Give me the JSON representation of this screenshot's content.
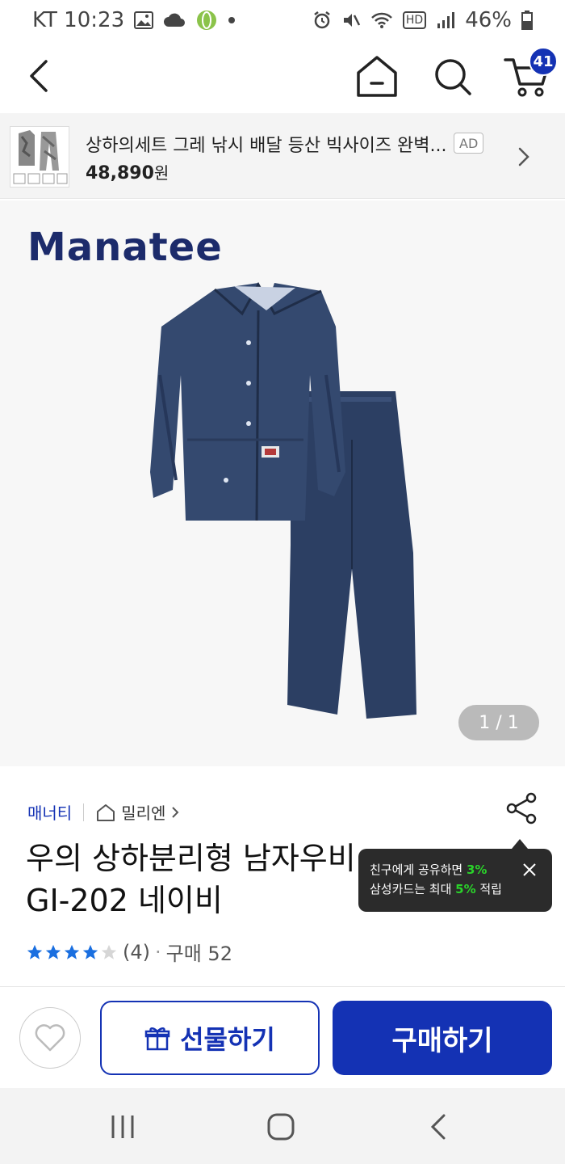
{
  "status_bar": {
    "carrier_time": "KT 10:23",
    "hd_label": "HD",
    "battery": "46%"
  },
  "nav": {
    "cart_count": "41"
  },
  "ad": {
    "title": "상하의세트 그레 낚시 배달 등산 빅사이즈 완벽...",
    "tag": "AD",
    "price": "48,890",
    "price_unit": "원"
  },
  "product_image": {
    "brand_logo": "Manatee",
    "page_indicator": "1 / 1"
  },
  "product": {
    "brand": "매너티",
    "store": "밀리엔",
    "title_line1": "우의 상하분리형 남자우비",
    "title_line2": "GI-202 네이비",
    "rating_stars": 4,
    "review_count": "(4)",
    "purchase_label": "구매 52"
  },
  "tooltip": {
    "line1_prefix": "친구에게 공유하면 ",
    "line1_highlight": "3%",
    "line2_prefix": "삼성카드는 최대 ",
    "line2_highlight": "5%",
    "line2_suffix": " 적립"
  },
  "actions": {
    "gift_label": "선물하기",
    "buy_label": "구매하기"
  },
  "colors": {
    "primary": "#1432b4",
    "highlight": "#2ad22a",
    "star": "#1a6fe0"
  }
}
